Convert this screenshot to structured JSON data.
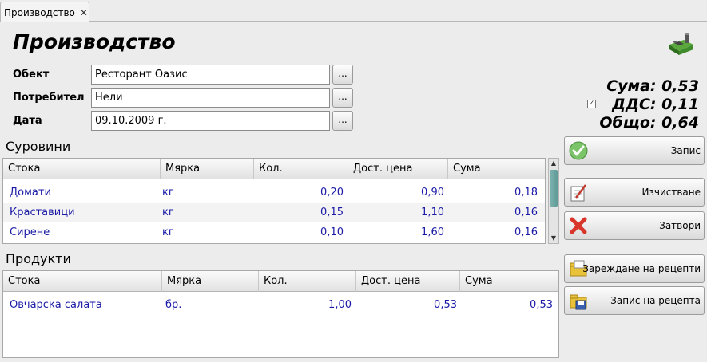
{
  "tab": {
    "label": "Производство",
    "close_glyph": "✕"
  },
  "page": {
    "title": "Производство"
  },
  "form": {
    "object_label": "Обект",
    "object_value": "Ресторант Оазис",
    "consumer_label": "Потребител",
    "consumer_value": "Нели",
    "date_label": "Дата",
    "date_value": "09.10.2009 г.",
    "dots_label": "..."
  },
  "totals": {
    "sum_label": "Сума:",
    "sum_value": "0,53",
    "vat_label": "ДДС:",
    "vat_value": "0,11",
    "vat_checked": true,
    "total_label": "Общо:",
    "total_value": "0,64"
  },
  "raw_materials": {
    "title": "Суровини",
    "columns": [
      "Стока",
      "Мярка",
      "Кол.",
      "Дост. цена",
      "Сума"
    ],
    "rows": [
      {
        "item": "Домати",
        "unit": "кг",
        "qty": "0,20",
        "price": "0,90",
        "sum": "0,18"
      },
      {
        "item": "Краставици",
        "unit": "кг",
        "qty": "0,15",
        "price": "1,10",
        "sum": "0,16"
      },
      {
        "item": "Сирене",
        "unit": "кг",
        "qty": "0,10",
        "price": "1,60",
        "sum": "0,16"
      }
    ]
  },
  "products": {
    "title": "Продукти",
    "columns": [
      "Стока",
      "Мярка",
      "Кол.",
      "Дост. цена",
      "Сума"
    ],
    "rows": [
      {
        "item": "Овчарска салата",
        "unit": "бр.",
        "qty": "1,00",
        "price": "0,53",
        "sum": "0,53"
      }
    ]
  },
  "buttons": {
    "save": "Запис",
    "clear": "Изчистване",
    "close": "Затвори",
    "load_recipes": "Зареждане на рецепти",
    "save_recipe": "Запис на рецепта"
  },
  "icons": {
    "factory": "factory-icon",
    "save": "check-icon",
    "clear": "clear-icon",
    "close": "close-x-icon",
    "load_recipes": "folder-load-icon",
    "save_recipe": "folder-save-icon"
  },
  "colors": {
    "cell_text": "#1a1aa6",
    "thumb": "#6aa6a2"
  }
}
